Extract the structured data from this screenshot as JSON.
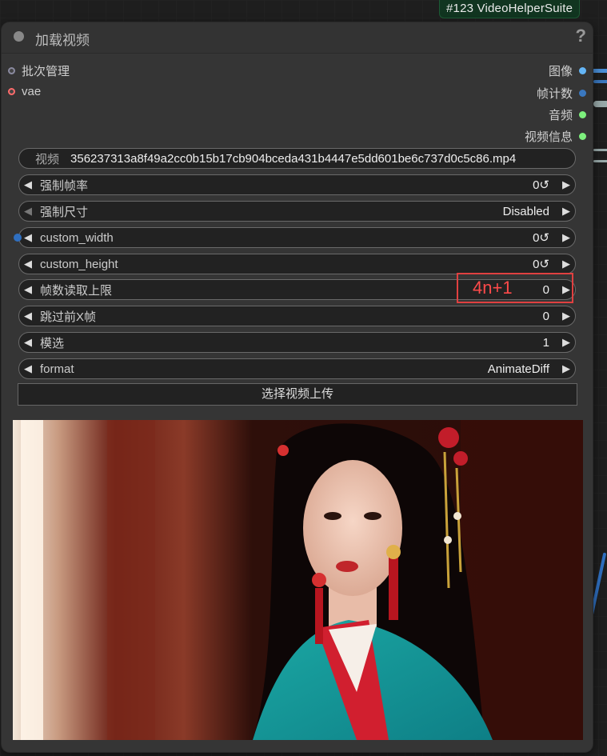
{
  "badge": "#123 VideoHelperSuite",
  "node": {
    "title": "加载视频",
    "help": "?"
  },
  "inputs": [
    {
      "label": "批次管理",
      "color": "#8a8aa0"
    },
    {
      "label": "vae",
      "color": "#ff6b6b"
    }
  ],
  "outputs": [
    {
      "label": "图像",
      "color": "#64b5f6"
    },
    {
      "label": "帧计数",
      "color": "#3a78c0"
    },
    {
      "label": "音频",
      "color": "#7df07d"
    },
    {
      "label": "视频信息",
      "color": "#7df07d"
    }
  ],
  "video_widget": {
    "label": "视频",
    "value": "356237313a8f49a2cc0b15b17cb904bceda431b4447e5dd601be6c737d0c5c86.mp4"
  },
  "widgets": [
    {
      "label": "强制帧率",
      "value": "0↺"
    },
    {
      "label": "强制尺寸",
      "value": "Disabled"
    },
    {
      "label": "custom_width",
      "value": "0↺"
    },
    {
      "label": "custom_height",
      "value": "0↺"
    },
    {
      "label": "帧数读取上限",
      "value": "0"
    },
    {
      "label": "跳过前X帧",
      "value": "0"
    },
    {
      "label": "模选",
      "value": "1"
    },
    {
      "label": "format",
      "value": "AnimateDiff"
    }
  ],
  "upload_button": "选择视频上传",
  "annotation": "4n+1",
  "colors": {
    "node_bg": "#353535",
    "widget_bg": "#222222",
    "badge_bg": "#113520",
    "annotation": "#e04040"
  }
}
